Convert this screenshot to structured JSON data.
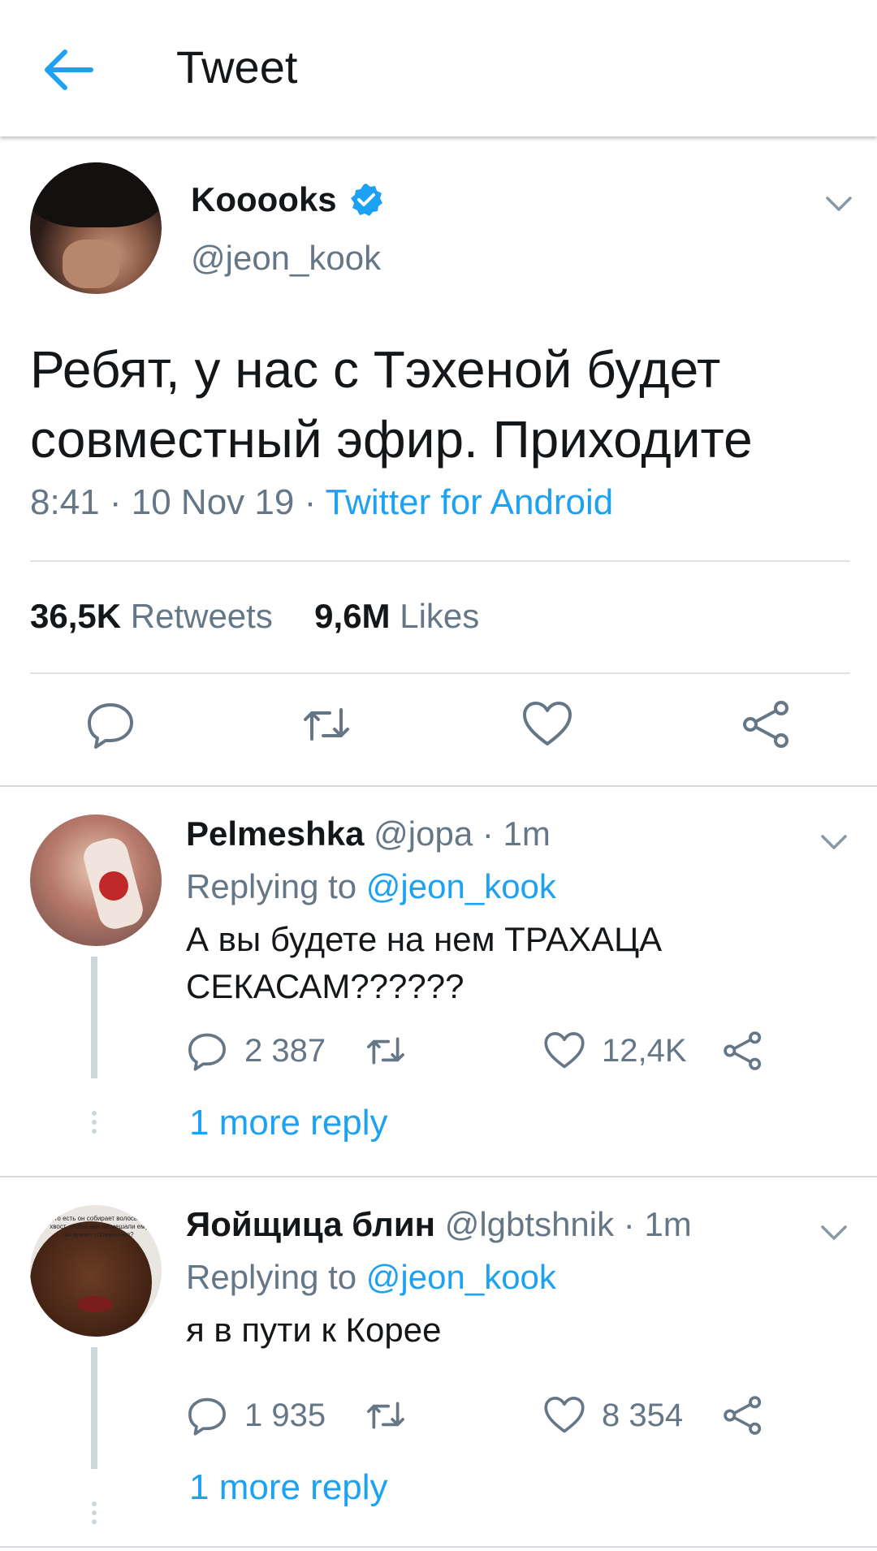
{
  "header": {
    "title": "Tweet"
  },
  "tweet": {
    "author_name": "Kooooks",
    "author_handle": "@jeon_kook",
    "text": "Ребят, у нас с Тэхеной будет совместный эфир. Приходите",
    "time": "8:41",
    "date": "10 Nov 19",
    "source": "Twitter for Android",
    "retweets_count": "36,5K",
    "retweets_label": "Retweets",
    "likes_count": "9,6M",
    "likes_label": "Likes"
  },
  "replies": [
    {
      "name": "Pelmeshka",
      "handle": "@jopa",
      "age": "1m",
      "replying_prefix": "Replying to",
      "replying_to": "@jeon_kook",
      "text": "А вы будете на нем ТРАХАЦА СЕКАСАМ??????",
      "reply_count": "2 387",
      "like_count": "12,4K",
      "more_label": "1 more reply"
    },
    {
      "name": "Яойщица блин",
      "handle": "@lgbtshnik",
      "age": "1m",
      "replying_prefix": "Replying to",
      "replying_to": "@jeon_kook",
      "text": "я в пути к Корее",
      "reply_count": "1 935",
      "like_count": "8 354",
      "more_label": "1 more reply",
      "avatar_caption": "то есть он собирает волосы в хвост, чтобы они не мешали ему во время упражнения?"
    }
  ],
  "colors": {
    "accent": "#1da1f2",
    "secondary_text": "#657786",
    "divider": "#dfe3e6"
  },
  "icons": [
    "back-arrow-icon",
    "verified-badge-icon",
    "chevron-down-icon",
    "reply-icon",
    "retweet-icon",
    "like-icon",
    "share-icon"
  ]
}
